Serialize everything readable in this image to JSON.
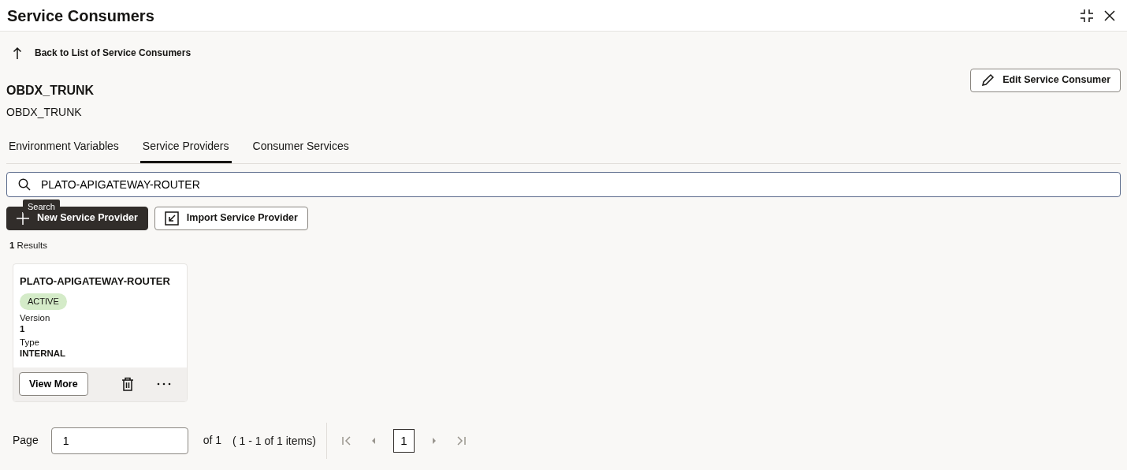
{
  "window": {
    "title": "Service Consumers"
  },
  "back_link": {
    "label": "Back to List of Service Consumers"
  },
  "consumer": {
    "name": "OBDX_TRUNK",
    "description": "OBDX_TRUNK"
  },
  "edit_button": {
    "label": "Edit Service Consumer"
  },
  "tabs": [
    {
      "label": "Environment Variables",
      "selected": false
    },
    {
      "label": "Service Providers",
      "selected": true
    },
    {
      "label": "Consumer Services",
      "selected": false
    }
  ],
  "search": {
    "value": "PLATO-APIGATEWAY-ROUTER"
  },
  "tooltip": "Search",
  "actions": [
    {
      "label": "New Service Provider",
      "kind": "primary"
    },
    {
      "label": "Import Service Provider",
      "kind": "secondary"
    }
  ],
  "results": {
    "count": "1",
    "label": "Results"
  },
  "cards": [
    {
      "title": "PLATO-APIGATEWAY-ROUTER",
      "status": "ACTIVE",
      "color": "#d4ebc8",
      "fields": [
        {
          "label": "Version",
          "value": "1"
        },
        {
          "label": "Type",
          "value": "INTERNAL"
        }
      ],
      "button": "View More"
    }
  ],
  "pagination": {
    "label": "Page",
    "value": "1",
    "of": "of 1",
    "range": "( 1 - 1 of 1 items)",
    "pages": [
      {
        "label": "1",
        "selected": true
      }
    ]
  }
}
